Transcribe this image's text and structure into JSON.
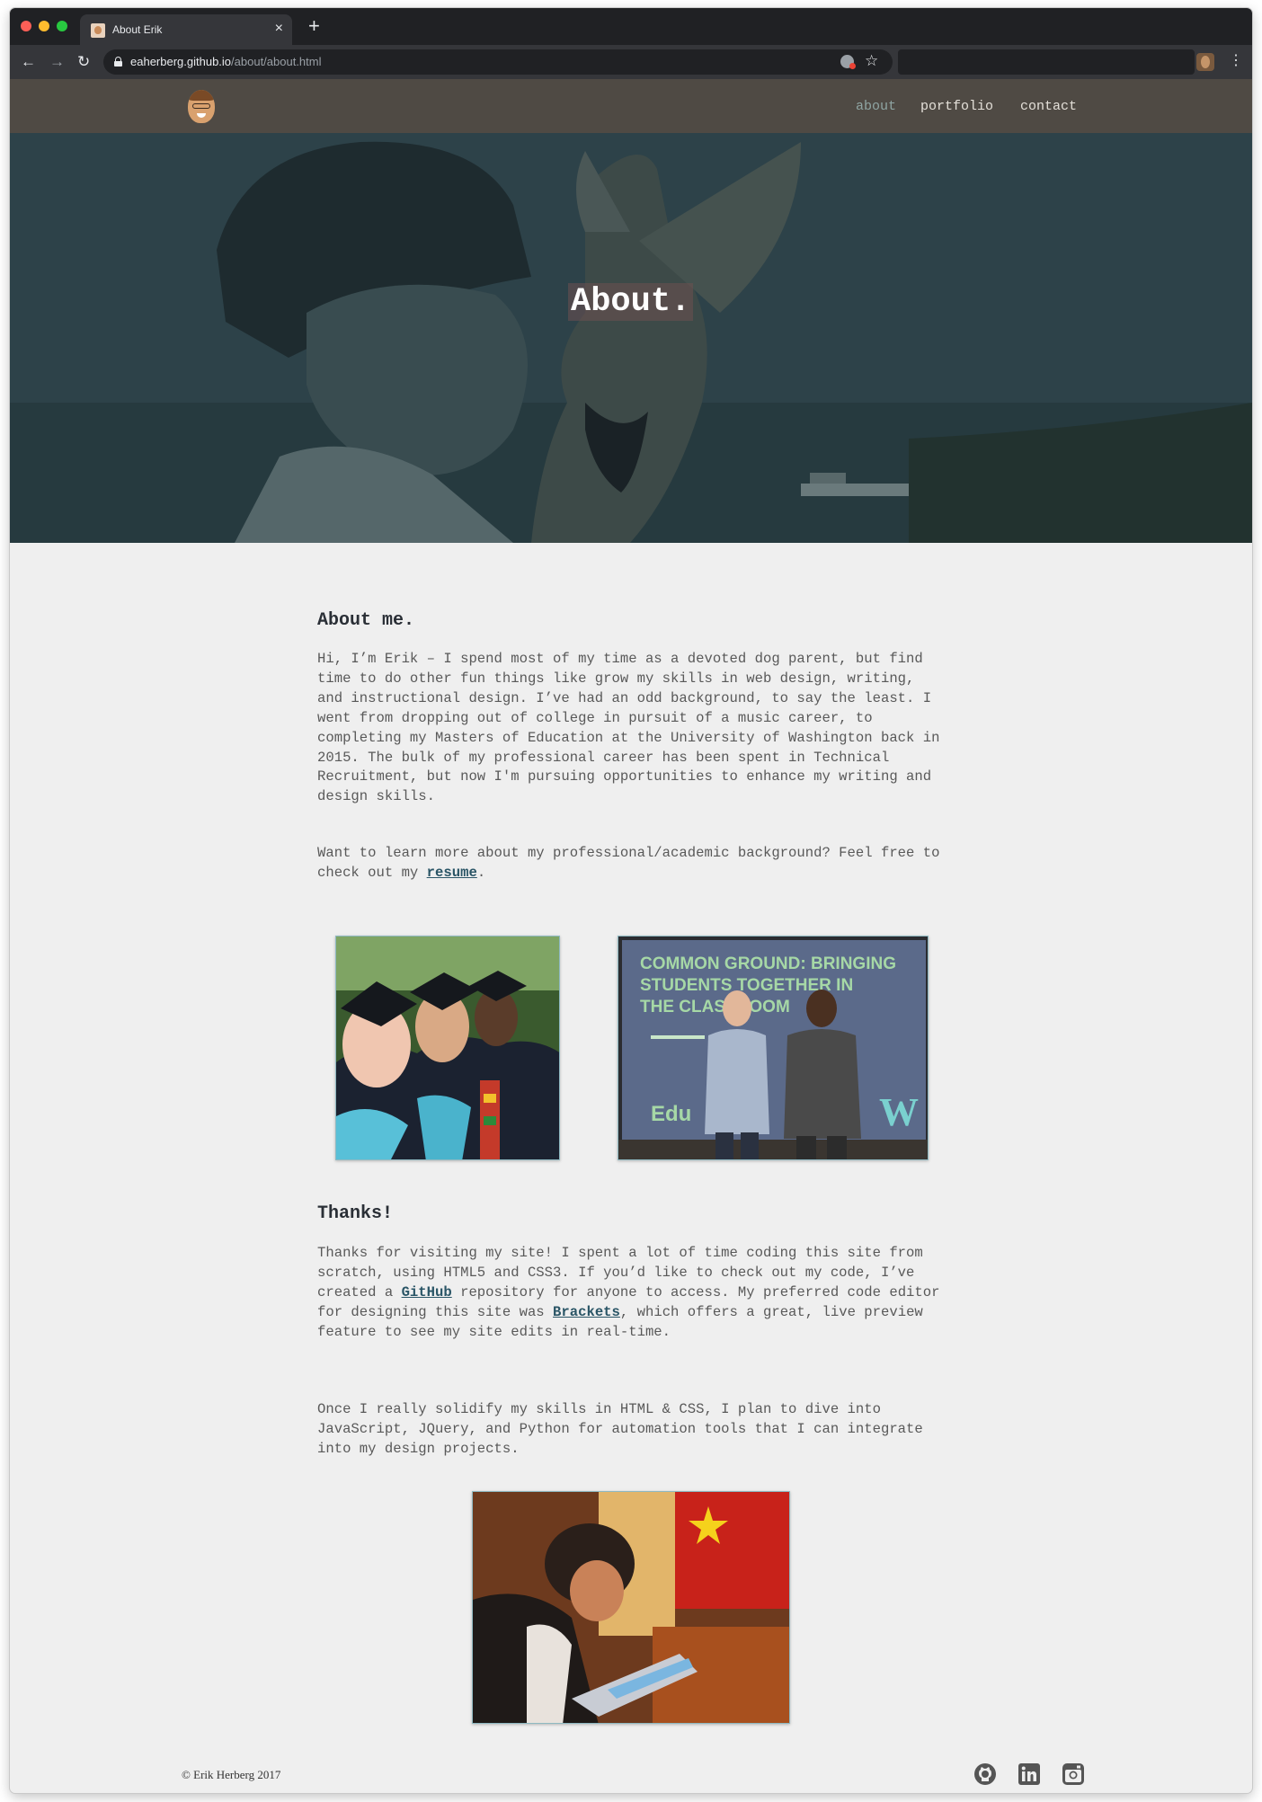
{
  "browser": {
    "tab_title": "About Erik",
    "tab_close": "×",
    "new_tab": "+",
    "url_host": "eaherberg.github.io",
    "url_path": "/about/about.html",
    "back": "←",
    "forward": "→",
    "reload": "↻",
    "star": "☆",
    "menu": "⋮"
  },
  "nav": {
    "items": [
      {
        "label": "about",
        "active": true
      },
      {
        "label": "portfolio",
        "active": false
      },
      {
        "label": "contact",
        "active": false
      }
    ]
  },
  "hero": {
    "title": "About."
  },
  "about": {
    "heading": "About me.",
    "paragraph1": "Hi, I’m Erik – I spend most of my time as a devoted dog parent, but find time to do other fun things like grow my skills in web design, writing, and instructional design. I’ve had an odd background, to say the least. I went from dropping out of college in pursuit of a music career, to completing my Masters of Education at the University of Washington back in 2015. The bulk of my professional career has been spent in Technical Recruitment, but now I'm pursuing opportunities to enhance my writing and design skills.",
    "paragraph2_before": "Want to learn more about my professional/academic background? Feel free to check out my ",
    "resume_link": "resume",
    "paragraph2_after": "."
  },
  "photos": {
    "slide_text": "COMMON GROUND: BRINGING STUDENTS TOGETHER IN THE CLASSROOM",
    "edu_logo": "Edu",
    "w_logo": "W"
  },
  "thanks": {
    "heading": "Thanks!",
    "p1_a": "Thanks for visiting my site! I spent a lot of time coding this site from scratch, using HTML5 and CSS3. If you’d like to check out my code, I’ve created a ",
    "github_link": "GitHub",
    "p1_b": " repository for anyone to access. My preferred code editor for designing this site was ",
    "brackets_link": "Brackets",
    "p1_c": ", which offers a great, live preview feature to see my site edits in real-time.",
    "p2": "Once I really solidify my skills in HTML & CSS, I plan to dive into JavaScript, JQuery, and Python for automation tools that I can integrate into my design projects."
  },
  "footer": {
    "copyright": "© Erik Herberg 2017",
    "icons": [
      "github-icon",
      "linkedin-icon",
      "instagram-icon"
    ]
  },
  "colors": {
    "header_bg": "#4f4a44",
    "nav_active": "#8fa5a3",
    "link": "#2a5566",
    "hero_tint": "#2b3e44",
    "page_bg": "#efefef"
  }
}
